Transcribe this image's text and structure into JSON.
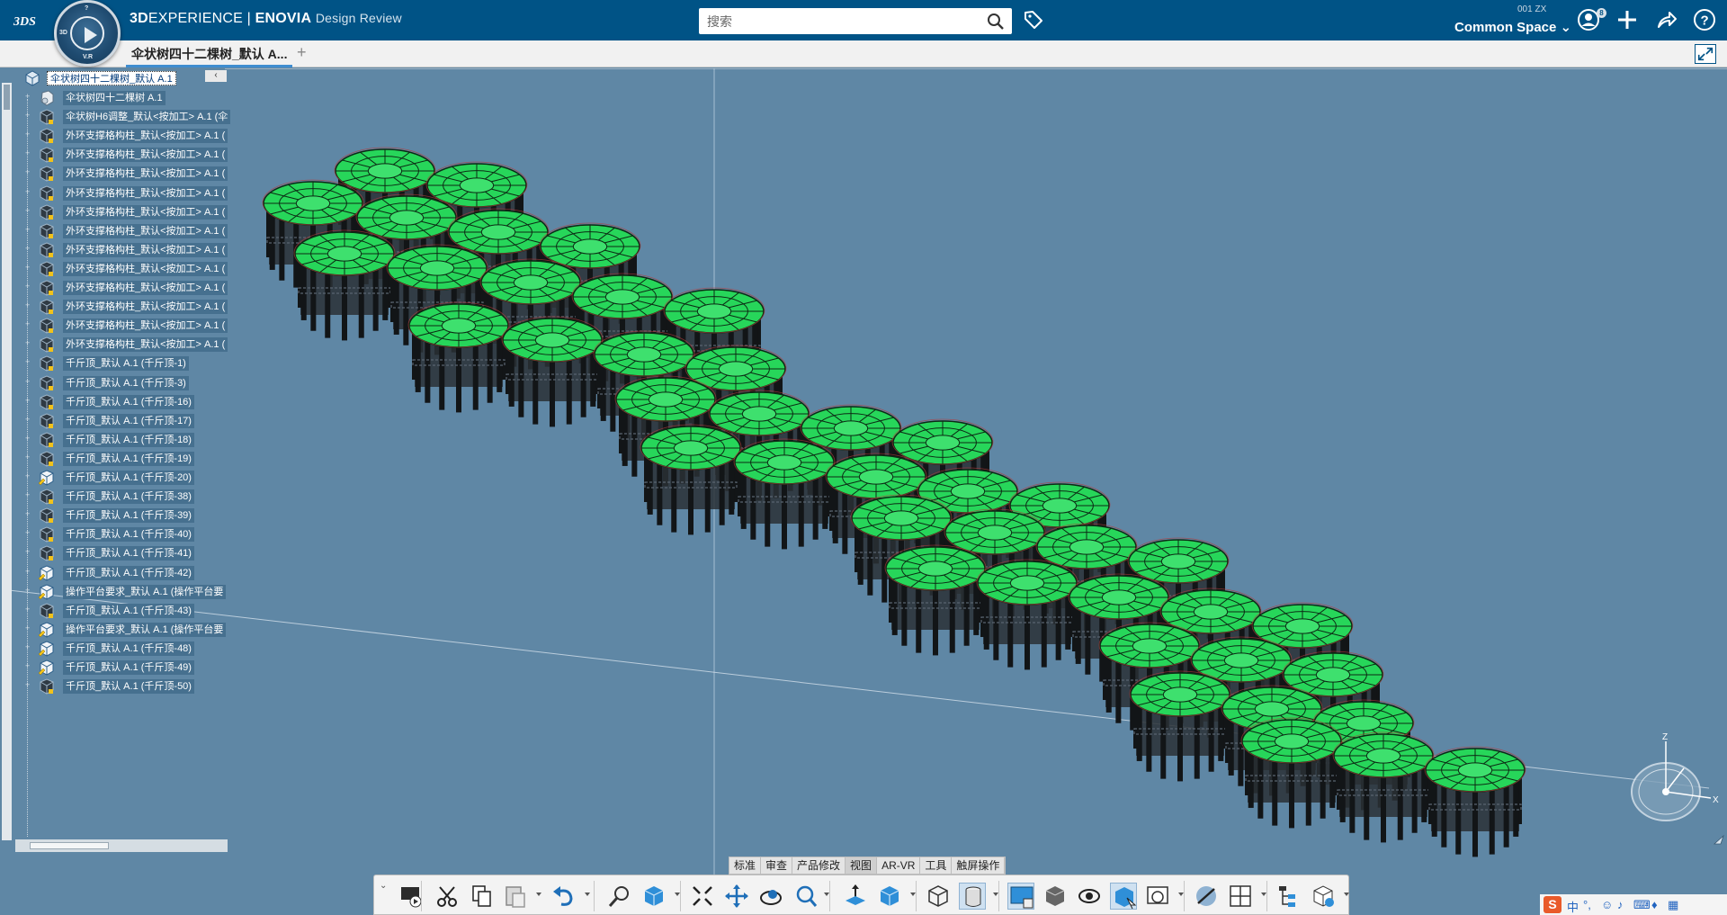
{
  "app": {
    "brand_bold": "3D",
    "brand_rest": "EXPERIENCE | ",
    "brand_app": "ENOVIA",
    "brand_role": "Design Review",
    "compass_top": "?",
    "compass_left": "3D",
    "compass_bottom": "V.R"
  },
  "search": {
    "placeholder": "搜索"
  },
  "space": {
    "user_code": "001 ZX",
    "name": "Common Space"
  },
  "user_badge": "8",
  "tab": {
    "label": "伞状树四十二棵树_默认 A...",
    "add": "+"
  },
  "tree": {
    "collapse_label": "‹",
    "root": "伞状树四十二棵树_默认 A.1",
    "items": [
      "伞状树四十二棵树 A.1",
      "伞状树H6调整_默认<按加工> A.1 (伞",
      "外环支撑格构柱_默认<按加工> A.1 (",
      "外环支撑格构柱_默认<按加工> A.1 (",
      "外环支撑格构柱_默认<按加工> A.1 (",
      "外环支撑格构柱_默认<按加工> A.1 (",
      "外环支撑格构柱_默认<按加工> A.1 (",
      "外环支撑格构柱_默认<按加工> A.1 (",
      "外环支撑格构柱_默认<按加工> A.1 (",
      "外环支撑格构柱_默认<按加工> A.1 (",
      "外环支撑格构柱_默认<按加工> A.1 (",
      "外环支撑格构柱_默认<按加工> A.1 (",
      "外环支撑格构柱_默认<按加工> A.1 (",
      "外环支撑格构柱_默认<按加工> A.1 (",
      "千斤顶_默认 A.1 (千斤顶-1)",
      "千斤顶_默认 A.1 (千斤顶-3)",
      "千斤顶_默认 A.1 (千斤顶-16)",
      "千斤顶_默认 A.1 (千斤顶-17)",
      "千斤顶_默认 A.1 (千斤顶-18)",
      "千斤顶_默认 A.1 (千斤顶-19)",
      "千斤顶_默认 A.1 (千斤顶-20)",
      "千斤顶_默认 A.1 (千斤顶-38)",
      "千斤顶_默认 A.1 (千斤顶-39)",
      "千斤顶_默认 A.1 (千斤顶-40)",
      "千斤顶_默认 A.1 (千斤顶-41)",
      "千斤顶_默认 A.1 (千斤顶-42)",
      "操作平台要求_默认 A.1 (操作平台要",
      "千斤顶_默认 A.1 (千斤顶-43)",
      "操作平台要求_默认 A.1 (操作平台要",
      "千斤顶_默认 A.1 (千斤顶-48)",
      "千斤顶_默认 A.1 (千斤顶-49)",
      "千斤顶_默认 A.1 (千斤顶-50)"
    ]
  },
  "compass3d": {
    "z": "Z",
    "x": "X"
  },
  "section_tabs": [
    "标准",
    "审查",
    "产品修改",
    "视图",
    "AR-VR",
    "工具",
    "触屏操作"
  ],
  "active_section": "视图",
  "ime": {
    "lang": "中",
    "punct": "°,"
  },
  "colors": {
    "topbar": "#005386",
    "viewport": "#5f87a5",
    "canopy": "#27d65a",
    "structure": "#1b1f22",
    "tab_accent": "#3f8dd0"
  }
}
